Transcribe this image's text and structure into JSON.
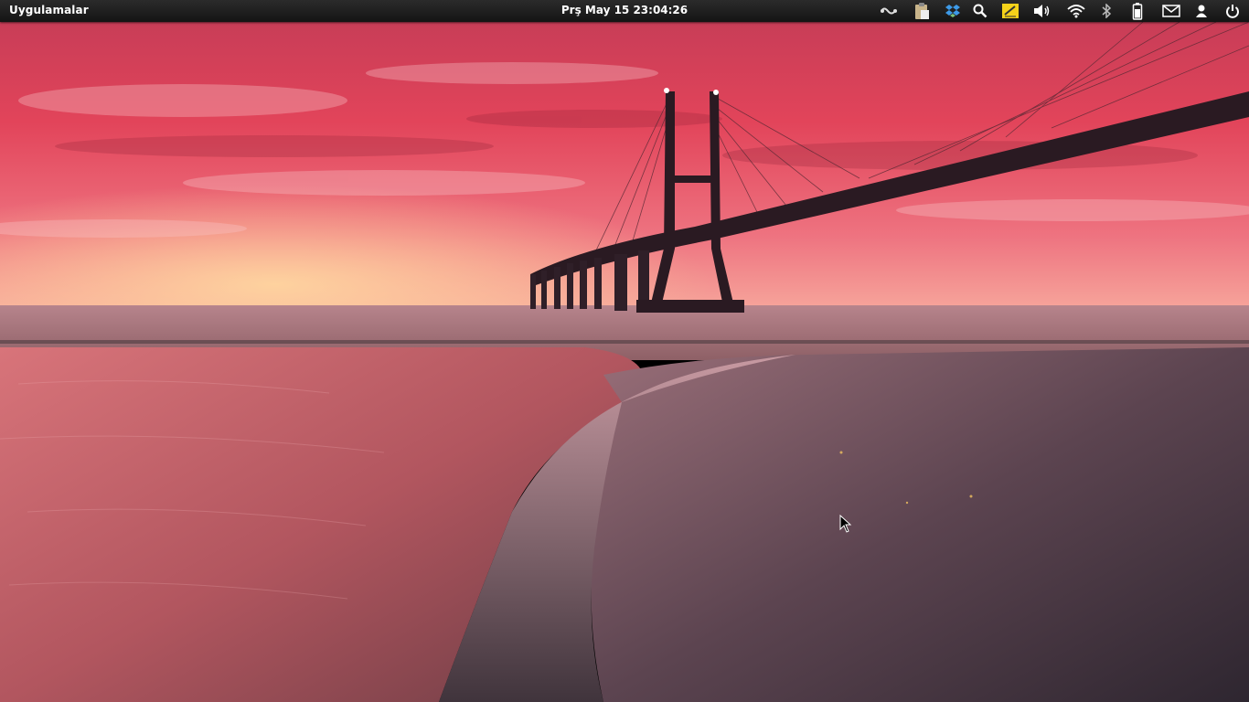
{
  "panel": {
    "apps_label": "Uygulamalar",
    "clock": "Prş May 15 23:04:26"
  },
  "tray_icons": [
    "keyboard-layout-icon",
    "clipboard-icon",
    "dropbox-icon",
    "search-icon",
    "notes-icon",
    "volume-icon",
    "wifi-icon",
    "bluetooth-icon",
    "battery-icon",
    "mail-icon",
    "user-icon",
    "power-icon"
  ],
  "desktop": {
    "wallpaper": "sunset-bridge-over-tidal-flats"
  },
  "colors": {
    "panel": "#1e1e1e",
    "sky_top": "#d9384a",
    "sky_horizon": "#f07a7a",
    "notes_accent": "#f5d21a",
    "dropbox": "#3d9ae8"
  }
}
